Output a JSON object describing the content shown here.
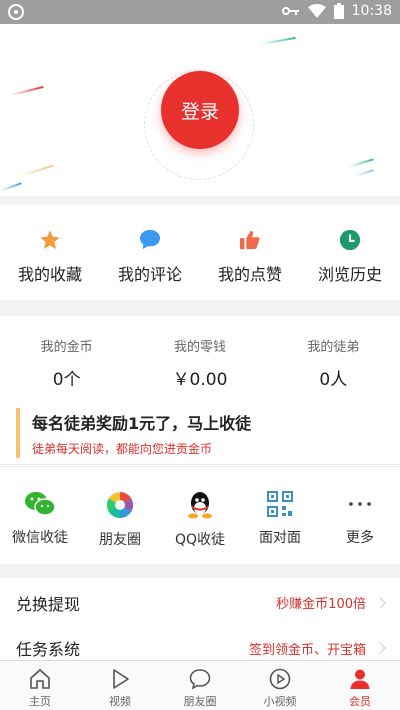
{
  "status_bar": {
    "time": "10:38"
  },
  "hero": {
    "login_label": "登录"
  },
  "quick_actions": [
    {
      "label": "我的收藏",
      "icon": "star-icon",
      "color": "#f39a3b"
    },
    {
      "label": "我的评论",
      "icon": "comment-icon",
      "color": "#3a9af0"
    },
    {
      "label": "我的点赞",
      "icon": "thumbs-up-icon",
      "color": "#f06a4a"
    },
    {
      "label": "浏览历史",
      "icon": "clock-icon",
      "color": "#1e9a6b"
    }
  ],
  "wallet": {
    "stats": [
      {
        "title": "我的金币",
        "value": "0个"
      },
      {
        "title": "我的零钱",
        "value": "￥0.00"
      },
      {
        "title": "我的徒弟",
        "value": "0人"
      }
    ],
    "invite_title": "每名徒弟奖励1元了，马上收徒",
    "invite_sub": "徒弟每天阅读，都能向您进贡金币"
  },
  "share": [
    {
      "label": "微信收徒",
      "icon": "wechat-icon"
    },
    {
      "label": "朋友圈",
      "icon": "moments-icon"
    },
    {
      "label": "QQ收徒",
      "icon": "qq-icon"
    },
    {
      "label": "面对面",
      "icon": "qr-code-icon"
    },
    {
      "label": "更多",
      "icon": "more-icon"
    }
  ],
  "menu": [
    {
      "label": "兑换提现",
      "hint": "秒赚金币100倍"
    },
    {
      "label": "任务系统",
      "hint": "签到领金币、开宝箱"
    }
  ],
  "tabs": [
    {
      "label": "主页",
      "icon": "home-icon"
    },
    {
      "label": "视频",
      "icon": "play-icon"
    },
    {
      "label": "朋友圈",
      "icon": "chat-bubble-icon"
    },
    {
      "label": "小视频",
      "icon": "short-video-icon"
    },
    {
      "label": "会员",
      "icon": "user-icon",
      "active": true
    }
  ],
  "colors": {
    "accent": "#e8302c",
    "invite_bar": "#f5c36b"
  }
}
